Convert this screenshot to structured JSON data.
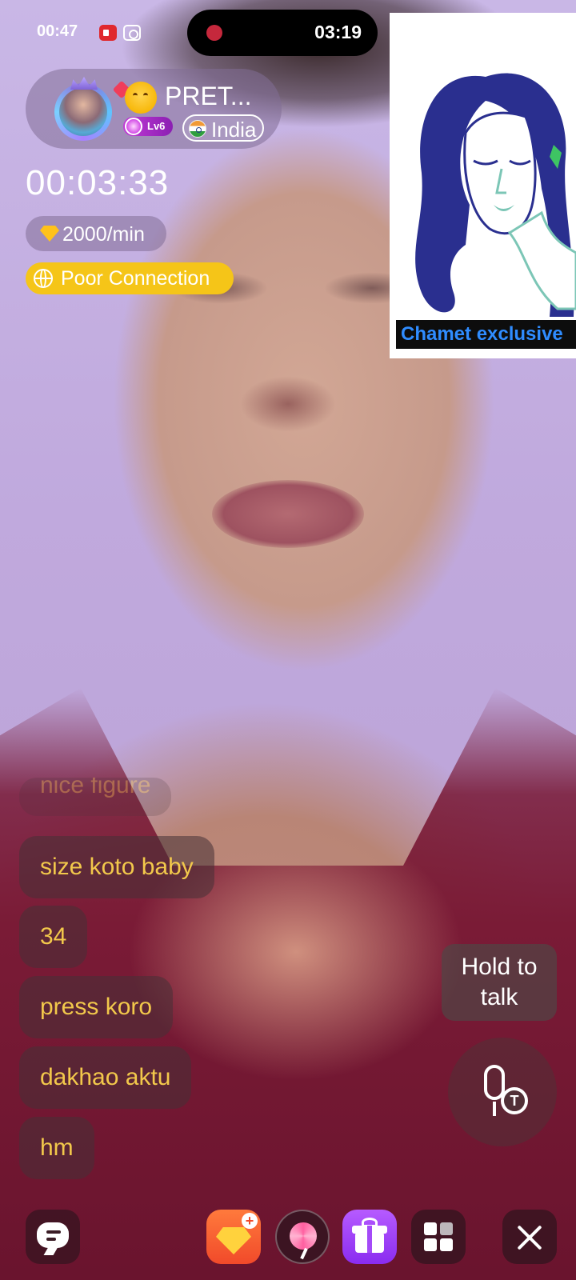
{
  "status_bar": {
    "time": "00:47",
    "icons": [
      "screen-record-icon",
      "camera-icon"
    ]
  },
  "recording": {
    "indicator": "recording-dot-icon",
    "elapsed": "03:19"
  },
  "profile": {
    "name": "PRET...",
    "name_emoji": "smiling-face-with-hearts-icon",
    "level": "Lv6",
    "country": "India",
    "country_flag": "india-flag-icon"
  },
  "call": {
    "timer": "00:03:33",
    "rate": "2000/min",
    "rate_icon": "diamond-icon",
    "connection_status": "Poor Connection",
    "connection_color": "#f5c518"
  },
  "pip": {
    "label": "Chamet exclusive",
    "label_color": "#2f8cff"
  },
  "chat": {
    "messages": [
      {
        "text": "nice figure"
      },
      {
        "text": "size koto baby"
      },
      {
        "text": "34"
      },
      {
        "text": "press koro"
      },
      {
        "text": "dakhao aktu"
      },
      {
        "text": "hm"
      }
    ],
    "text_color": "#f2c84b"
  },
  "voice": {
    "hold_label": "Hold to talk",
    "mic_icon": "voice-to-text-mic-icon"
  },
  "bottom_bar": {
    "items": [
      {
        "icon": "chat-icon"
      },
      {
        "icon": "recharge-gems-icon"
      },
      {
        "icon": "lollipop-icon"
      },
      {
        "icon": "gift-icon"
      },
      {
        "icon": "grid-menu-icon"
      },
      {
        "icon": "close-icon"
      }
    ]
  }
}
